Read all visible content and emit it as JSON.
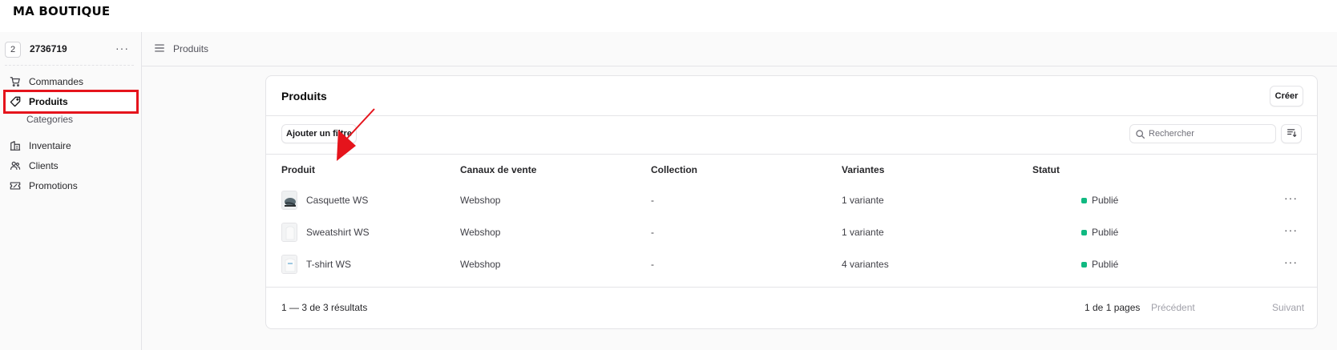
{
  "brand": "MA BOUTIQUE",
  "store": {
    "badge": "2",
    "id": "2736719",
    "more": "···"
  },
  "sidebar": {
    "items": [
      {
        "label": "Commandes",
        "icon": "cart-icon"
      },
      {
        "label": "Produits",
        "icon": "tag-icon",
        "active": true
      },
      {
        "label": "Inventaire",
        "icon": "warehouse-icon"
      },
      {
        "label": "Clients",
        "icon": "users-icon"
      },
      {
        "label": "Promotions",
        "icon": "ticket-icon"
      }
    ],
    "sub_item": "Categories"
  },
  "topbar": {
    "breadcrumb": "Produits"
  },
  "card": {
    "title": "Produits",
    "create_label": "Créer",
    "filter_label": "Ajouter un filtre",
    "search_placeholder": "Rechercher"
  },
  "table": {
    "columns": [
      "Produit",
      "Canaux de vente",
      "Collection",
      "Variantes",
      "Statut"
    ],
    "rows": [
      {
        "name": "Casquette WS",
        "channel": "Webshop",
        "collection": "-",
        "variants": "1 variante",
        "status": "Publié",
        "more": "···"
      },
      {
        "name": "Sweatshirt WS",
        "channel": "Webshop",
        "collection": "-",
        "variants": "1 variante",
        "status": "Publié",
        "more": "···"
      },
      {
        "name": "T-shirt WS",
        "channel": "Webshop",
        "collection": "-",
        "variants": "4 variantes",
        "status": "Publié",
        "more": "···"
      }
    ]
  },
  "footer": {
    "results": "1 — 3 de 3 résultats",
    "pages": "1 de 1 pages",
    "prev": "Précédent",
    "next": "Suivant"
  },
  "colors": {
    "status_published": "#10b981",
    "highlight": "#e5141c"
  }
}
